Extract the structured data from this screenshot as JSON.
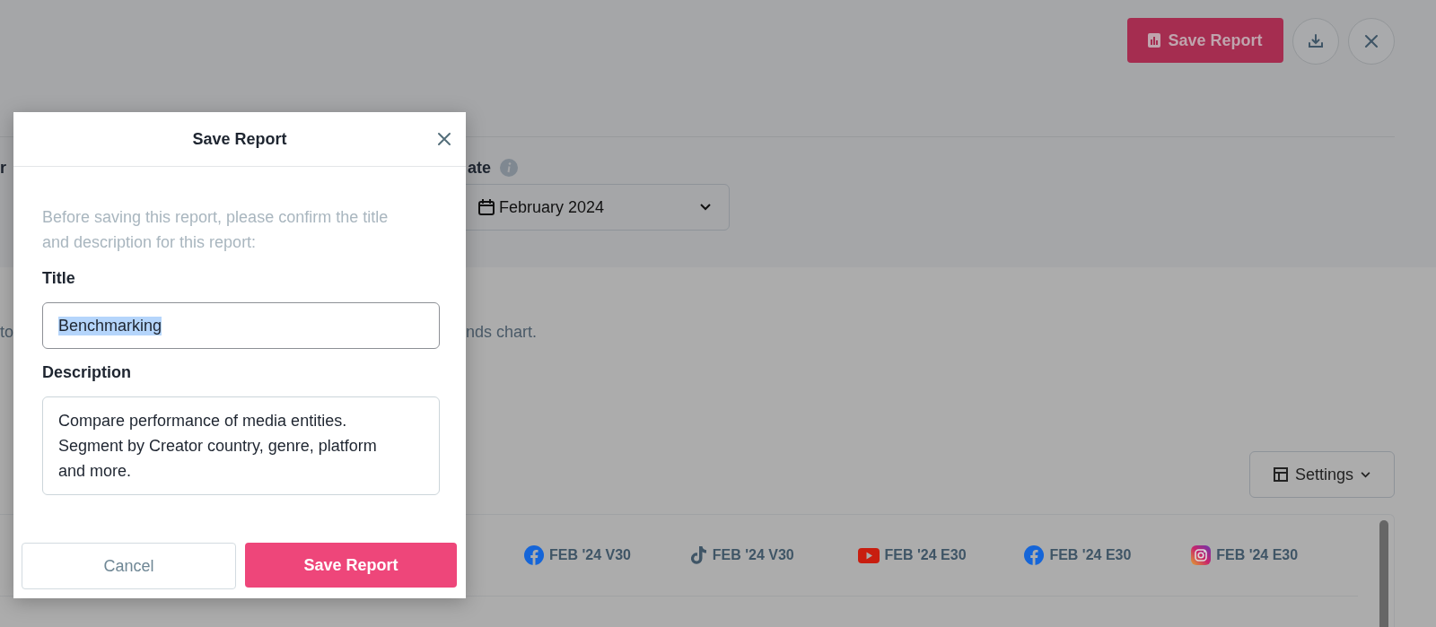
{
  "header": {
    "actions": [
      {
        "kind": "save",
        "label": "Save Report"
      },
      {
        "kind": "download"
      },
      {
        "kind": "close"
      }
    ]
  },
  "filters": {
    "label_1": "r",
    "label_2": "ate",
    "date_field": {
      "value": "February 2024"
    }
  },
  "description_fragments": [
    "to",
    "nds chart."
  ],
  "settings_button": {
    "label": "Settings"
  },
  "table": {
    "columns": [
      {
        "kind": "facebook",
        "label": "FEB '24 V30"
      },
      {
        "kind": "tiktok",
        "label": "FEB '24 V30"
      },
      {
        "kind": "youtube",
        "label": "FEB '24 E30"
      },
      {
        "kind": "facebook",
        "label": "FEB '24 E30"
      },
      {
        "kind": "instagram",
        "label": "FEB '24 E30"
      }
    ]
  },
  "dialog": {
    "title": "Save Report",
    "intro": "Before saving this report, please confirm the title and description for this report:",
    "fields": [
      {
        "kind": "input",
        "label": "Title",
        "value": "Benchmarking",
        "text_selected": true
      },
      {
        "kind": "textarea",
        "label": "Description",
        "value": "Compare performance of media entities. Segment by Creator country, genre, platform and more.",
        "text_selected": false
      }
    ],
    "buttons": [
      {
        "kind": "secondary",
        "label": "Cancel"
      },
      {
        "kind": "primary",
        "label": "Save Report"
      }
    ]
  }
}
